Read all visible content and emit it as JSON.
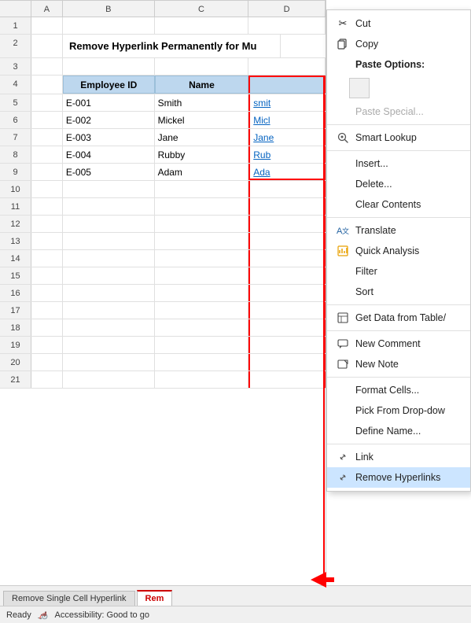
{
  "spreadsheet": {
    "columns": {
      "corner": "",
      "a": "A",
      "b": "B",
      "c": "C",
      "d": "D"
    },
    "rows": [
      {
        "num": "1",
        "a": "",
        "b": "",
        "c": "",
        "d": ""
      },
      {
        "num": "2",
        "a": "",
        "b": "Remove Hyperlink Permanently for Mu",
        "c": "",
        "d": ""
      },
      {
        "num": "3",
        "a": "",
        "b": "",
        "c": "",
        "d": ""
      },
      {
        "num": "4",
        "a": "",
        "b": "Employee ID",
        "c": "Name",
        "d": ""
      },
      {
        "num": "5",
        "a": "",
        "b": "E-001",
        "c": "Smith",
        "d": "smit"
      },
      {
        "num": "6",
        "a": "",
        "b": "E-002",
        "c": "Mickel",
        "d": "Micl"
      },
      {
        "num": "7",
        "a": "",
        "b": "E-003",
        "c": "Jane",
        "d": "Jane"
      },
      {
        "num": "8",
        "a": "",
        "b": "E-004",
        "c": "Rubby",
        "d": "Rub"
      },
      {
        "num": "9",
        "a": "",
        "b": "E-005",
        "c": "Adam",
        "d": "Ada"
      },
      {
        "num": "10",
        "a": "",
        "b": "",
        "c": "",
        "d": ""
      },
      {
        "num": "11",
        "a": "",
        "b": "",
        "c": "",
        "d": ""
      },
      {
        "num": "12",
        "a": "",
        "b": "",
        "c": "",
        "d": ""
      },
      {
        "num": "13",
        "a": "",
        "b": "",
        "c": "",
        "d": ""
      },
      {
        "num": "14",
        "a": "",
        "b": "",
        "c": "",
        "d": ""
      },
      {
        "num": "15",
        "a": "",
        "b": "",
        "c": "",
        "d": ""
      },
      {
        "num": "16",
        "a": "",
        "b": "",
        "c": "",
        "d": ""
      },
      {
        "num": "17",
        "a": "",
        "b": "",
        "c": "",
        "d": ""
      },
      {
        "num": "18",
        "a": "",
        "b": "",
        "c": "",
        "d": ""
      },
      {
        "num": "19",
        "a": "",
        "b": "",
        "c": "",
        "d": ""
      },
      {
        "num": "20",
        "a": "",
        "b": "",
        "c": "",
        "d": ""
      },
      {
        "num": "21",
        "a": "",
        "b": "",
        "c": "",
        "d": ""
      }
    ]
  },
  "context_menu": {
    "items": [
      {
        "id": "cut",
        "icon": "✂",
        "label": "Cut",
        "enabled": true
      },
      {
        "id": "copy",
        "icon": "📋",
        "label": "Copy",
        "enabled": true
      },
      {
        "id": "paste-options-title",
        "label": "Paste Options:",
        "type": "title",
        "enabled": false
      },
      {
        "id": "paste-special",
        "icon": "",
        "label": "Paste Special...",
        "enabled": false
      },
      {
        "id": "sep1",
        "type": "separator"
      },
      {
        "id": "smart-lookup",
        "icon": "🔍",
        "label": "Smart Lookup",
        "enabled": true
      },
      {
        "id": "sep2",
        "type": "separator"
      },
      {
        "id": "insert",
        "icon": "",
        "label": "Insert...",
        "enabled": true
      },
      {
        "id": "delete",
        "icon": "",
        "label": "Delete...",
        "enabled": true
      },
      {
        "id": "clear-contents",
        "icon": "",
        "label": "Clear Contents",
        "enabled": true
      },
      {
        "id": "sep3",
        "type": "separator"
      },
      {
        "id": "translate",
        "icon": "🌐",
        "label": "Translate",
        "enabled": true
      },
      {
        "id": "quick-analysis",
        "icon": "⚡",
        "label": "Quick Analysis",
        "enabled": true
      },
      {
        "id": "filter",
        "icon": "",
        "label": "Filter",
        "enabled": true
      },
      {
        "id": "sort",
        "icon": "",
        "label": "Sort",
        "enabled": true
      },
      {
        "id": "sep4",
        "type": "separator"
      },
      {
        "id": "get-data",
        "icon": "📊",
        "label": "Get Data from Table/",
        "enabled": true
      },
      {
        "id": "sep5",
        "type": "separator"
      },
      {
        "id": "new-comment",
        "icon": "💬",
        "label": "New Comment",
        "enabled": true
      },
      {
        "id": "new-note",
        "icon": "📝",
        "label": "New Note",
        "enabled": true
      },
      {
        "id": "sep6",
        "type": "separator"
      },
      {
        "id": "format-cells",
        "icon": "",
        "label": "Format Cells...",
        "enabled": true
      },
      {
        "id": "pick-from-dropdown",
        "icon": "",
        "label": "Pick From Drop-dow",
        "enabled": true
      },
      {
        "id": "define-name",
        "icon": "",
        "label": "Define Name...",
        "enabled": true
      },
      {
        "id": "sep7",
        "type": "separator"
      },
      {
        "id": "link",
        "icon": "🔗",
        "label": "Link",
        "enabled": true
      },
      {
        "id": "remove-hyperlinks",
        "icon": "🔗",
        "label": "Remove Hyperlinks",
        "enabled": true,
        "highlighted": true
      }
    ]
  },
  "sheet_tabs": [
    {
      "id": "tab1",
      "label": "Remove Single Cell Hyperlink",
      "active": false
    },
    {
      "id": "tab2",
      "label": "Rem",
      "active": true
    }
  ],
  "status_bar": {
    "ready": "Ready",
    "accessibility": "🦽",
    "accessibility_text": "Accessibility: Good to go"
  }
}
